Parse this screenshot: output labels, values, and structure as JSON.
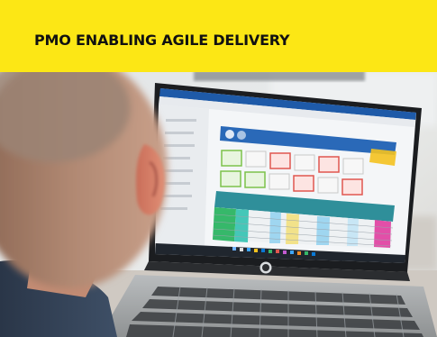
{
  "banner": {
    "title": "PMO ENABLING AGILE DELIVERY",
    "background": "#fce715"
  },
  "photo": {
    "subject": "person-viewing-laptop-dashboard",
    "laptop_brand_logo": "hp",
    "screen_palette": {
      "header_blue": "#1e5aa8",
      "table_teal": "#2f8f9a",
      "table_green": "#36b86a",
      "table_pink": "#e24fa8",
      "tile_green": "#7cc24a",
      "tile_red": "#e0574f",
      "accent_yellow": "#f4c21f"
    },
    "taskbar_icons": [
      "windows-icon",
      "search-icon",
      "browser-icon",
      "folder-icon",
      "mail-icon",
      "app-icon",
      "app-icon",
      "app-icon",
      "app-icon",
      "app-icon",
      "app-icon",
      "app-icon"
    ]
  }
}
